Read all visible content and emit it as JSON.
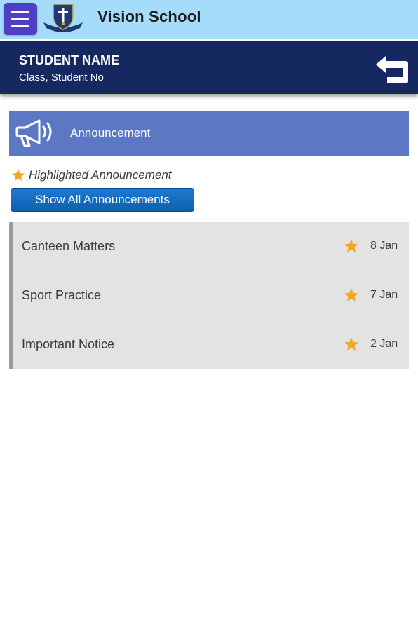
{
  "header": {
    "app_title": "Vision School",
    "menu_icon": "hamburger-menu-icon",
    "logo": "school-crest-logo",
    "brand_color": "#a6dcfb",
    "menu_color": "#4f3fc6"
  },
  "student": {
    "name": "STUDENT NAME",
    "meta": "Class, Student No",
    "back_icon": "return-arrow-icon",
    "bar_color": "#162860"
  },
  "section": {
    "title": "Announcement",
    "icon": "megaphone-icon",
    "color": "#5c78c4"
  },
  "legend": {
    "icon": "star-icon",
    "text": "Highlighted Announcement"
  },
  "show_all_label": "Show All Announcements",
  "announcements": [
    {
      "title": "Canteen Matters",
      "date": "8 Jan",
      "highlighted": true
    },
    {
      "title": "Sport Practice",
      "date": "7 Jan",
      "highlighted": true
    },
    {
      "title": "Important Notice",
      "date": "2 Jan",
      "highlighted": true
    }
  ]
}
